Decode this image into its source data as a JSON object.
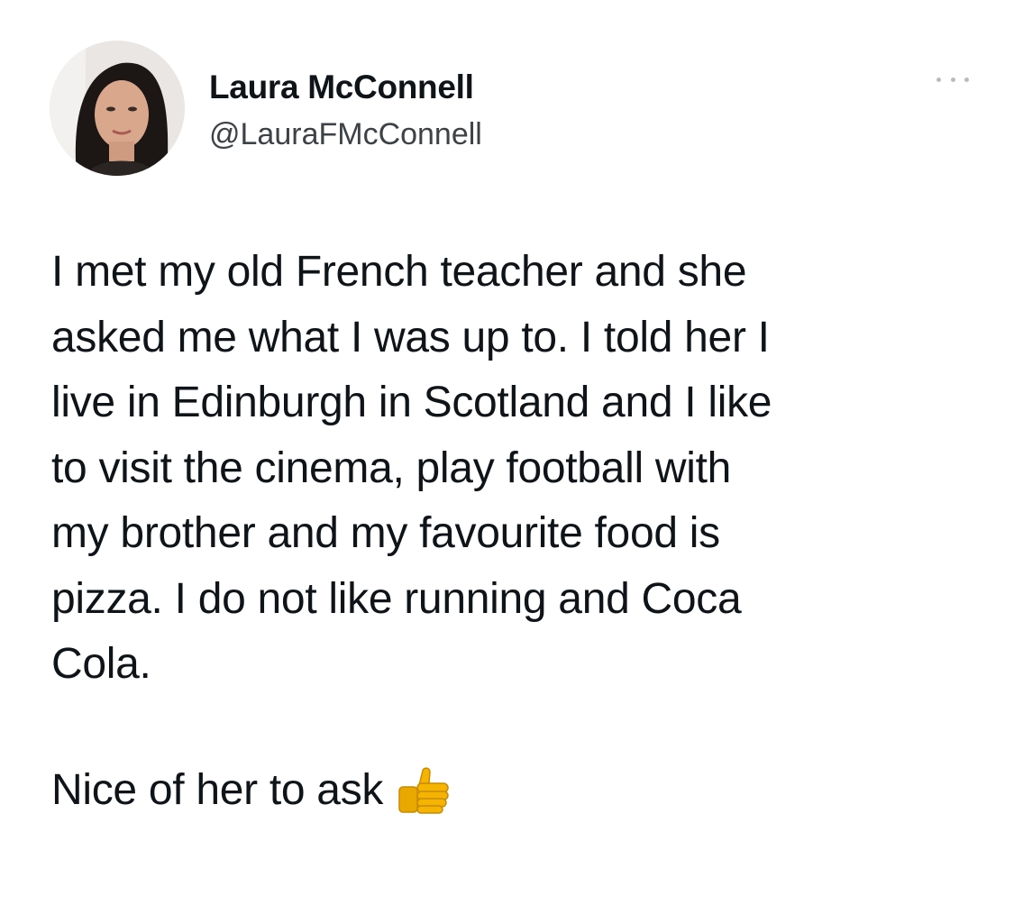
{
  "author": {
    "display_name": "Laura McConnell",
    "handle": "@LauraFMcConnell",
    "avatar_icon": "profile-photo"
  },
  "menu": {
    "icon": "more-options-icon"
  },
  "tweet": {
    "lines": [
      "I met my old French teacher and she",
      "asked me what I was up to. I told her I",
      "live in Edinburgh in Scotland and I like",
      "to visit the cinema, play football with",
      "my brother and my favourite food is",
      "pizza. I do not like running and Coca",
      "Cola."
    ],
    "closing": "Nice of her to ask",
    "closing_emoji": "thumbs-up-icon"
  },
  "colors": {
    "text": "#0f1419",
    "handle": "#3d4246",
    "dots": "#b8bcc0",
    "emoji": "#f4b400"
  }
}
